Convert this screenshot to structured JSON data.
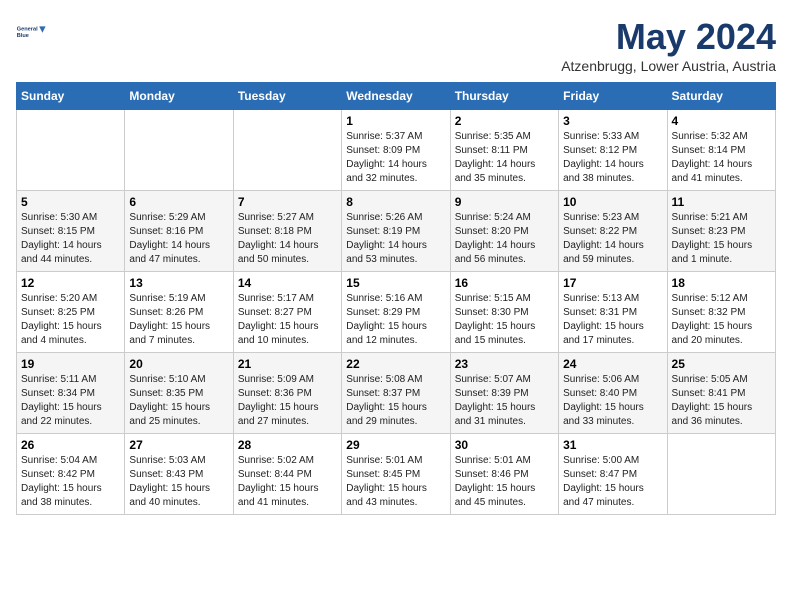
{
  "header": {
    "logo_line1": "General",
    "logo_line2": "Blue",
    "month": "May 2024",
    "location": "Atzenbrugg, Lower Austria, Austria"
  },
  "weekdays": [
    "Sunday",
    "Monday",
    "Tuesday",
    "Wednesday",
    "Thursday",
    "Friday",
    "Saturday"
  ],
  "weeks": [
    [
      {
        "day": "",
        "sunrise": "",
        "sunset": "",
        "daylight": ""
      },
      {
        "day": "",
        "sunrise": "",
        "sunset": "",
        "daylight": ""
      },
      {
        "day": "",
        "sunrise": "",
        "sunset": "",
        "daylight": ""
      },
      {
        "day": "1",
        "sunrise": "Sunrise: 5:37 AM",
        "sunset": "Sunset: 8:09 PM",
        "daylight": "Daylight: 14 hours and 32 minutes."
      },
      {
        "day": "2",
        "sunrise": "Sunrise: 5:35 AM",
        "sunset": "Sunset: 8:11 PM",
        "daylight": "Daylight: 14 hours and 35 minutes."
      },
      {
        "day": "3",
        "sunrise": "Sunrise: 5:33 AM",
        "sunset": "Sunset: 8:12 PM",
        "daylight": "Daylight: 14 hours and 38 minutes."
      },
      {
        "day": "4",
        "sunrise": "Sunrise: 5:32 AM",
        "sunset": "Sunset: 8:14 PM",
        "daylight": "Daylight: 14 hours and 41 minutes."
      }
    ],
    [
      {
        "day": "5",
        "sunrise": "Sunrise: 5:30 AM",
        "sunset": "Sunset: 8:15 PM",
        "daylight": "Daylight: 14 hours and 44 minutes."
      },
      {
        "day": "6",
        "sunrise": "Sunrise: 5:29 AM",
        "sunset": "Sunset: 8:16 PM",
        "daylight": "Daylight: 14 hours and 47 minutes."
      },
      {
        "day": "7",
        "sunrise": "Sunrise: 5:27 AM",
        "sunset": "Sunset: 8:18 PM",
        "daylight": "Daylight: 14 hours and 50 minutes."
      },
      {
        "day": "8",
        "sunrise": "Sunrise: 5:26 AM",
        "sunset": "Sunset: 8:19 PM",
        "daylight": "Daylight: 14 hours and 53 minutes."
      },
      {
        "day": "9",
        "sunrise": "Sunrise: 5:24 AM",
        "sunset": "Sunset: 8:20 PM",
        "daylight": "Daylight: 14 hours and 56 minutes."
      },
      {
        "day": "10",
        "sunrise": "Sunrise: 5:23 AM",
        "sunset": "Sunset: 8:22 PM",
        "daylight": "Daylight: 14 hours and 59 minutes."
      },
      {
        "day": "11",
        "sunrise": "Sunrise: 5:21 AM",
        "sunset": "Sunset: 8:23 PM",
        "daylight": "Daylight: 15 hours and 1 minute."
      }
    ],
    [
      {
        "day": "12",
        "sunrise": "Sunrise: 5:20 AM",
        "sunset": "Sunset: 8:25 PM",
        "daylight": "Daylight: 15 hours and 4 minutes."
      },
      {
        "day": "13",
        "sunrise": "Sunrise: 5:19 AM",
        "sunset": "Sunset: 8:26 PM",
        "daylight": "Daylight: 15 hours and 7 minutes."
      },
      {
        "day": "14",
        "sunrise": "Sunrise: 5:17 AM",
        "sunset": "Sunset: 8:27 PM",
        "daylight": "Daylight: 15 hours and 10 minutes."
      },
      {
        "day": "15",
        "sunrise": "Sunrise: 5:16 AM",
        "sunset": "Sunset: 8:29 PM",
        "daylight": "Daylight: 15 hours and 12 minutes."
      },
      {
        "day": "16",
        "sunrise": "Sunrise: 5:15 AM",
        "sunset": "Sunset: 8:30 PM",
        "daylight": "Daylight: 15 hours and 15 minutes."
      },
      {
        "day": "17",
        "sunrise": "Sunrise: 5:13 AM",
        "sunset": "Sunset: 8:31 PM",
        "daylight": "Daylight: 15 hours and 17 minutes."
      },
      {
        "day": "18",
        "sunrise": "Sunrise: 5:12 AM",
        "sunset": "Sunset: 8:32 PM",
        "daylight": "Daylight: 15 hours and 20 minutes."
      }
    ],
    [
      {
        "day": "19",
        "sunrise": "Sunrise: 5:11 AM",
        "sunset": "Sunset: 8:34 PM",
        "daylight": "Daylight: 15 hours and 22 minutes."
      },
      {
        "day": "20",
        "sunrise": "Sunrise: 5:10 AM",
        "sunset": "Sunset: 8:35 PM",
        "daylight": "Daylight: 15 hours and 25 minutes."
      },
      {
        "day": "21",
        "sunrise": "Sunrise: 5:09 AM",
        "sunset": "Sunset: 8:36 PM",
        "daylight": "Daylight: 15 hours and 27 minutes."
      },
      {
        "day": "22",
        "sunrise": "Sunrise: 5:08 AM",
        "sunset": "Sunset: 8:37 PM",
        "daylight": "Daylight: 15 hours and 29 minutes."
      },
      {
        "day": "23",
        "sunrise": "Sunrise: 5:07 AM",
        "sunset": "Sunset: 8:39 PM",
        "daylight": "Daylight: 15 hours and 31 minutes."
      },
      {
        "day": "24",
        "sunrise": "Sunrise: 5:06 AM",
        "sunset": "Sunset: 8:40 PM",
        "daylight": "Daylight: 15 hours and 33 minutes."
      },
      {
        "day": "25",
        "sunrise": "Sunrise: 5:05 AM",
        "sunset": "Sunset: 8:41 PM",
        "daylight": "Daylight: 15 hours and 36 minutes."
      }
    ],
    [
      {
        "day": "26",
        "sunrise": "Sunrise: 5:04 AM",
        "sunset": "Sunset: 8:42 PM",
        "daylight": "Daylight: 15 hours and 38 minutes."
      },
      {
        "day": "27",
        "sunrise": "Sunrise: 5:03 AM",
        "sunset": "Sunset: 8:43 PM",
        "daylight": "Daylight: 15 hours and 40 minutes."
      },
      {
        "day": "28",
        "sunrise": "Sunrise: 5:02 AM",
        "sunset": "Sunset: 8:44 PM",
        "daylight": "Daylight: 15 hours and 41 minutes."
      },
      {
        "day": "29",
        "sunrise": "Sunrise: 5:01 AM",
        "sunset": "Sunset: 8:45 PM",
        "daylight": "Daylight: 15 hours and 43 minutes."
      },
      {
        "day": "30",
        "sunrise": "Sunrise: 5:01 AM",
        "sunset": "Sunset: 8:46 PM",
        "daylight": "Daylight: 15 hours and 45 minutes."
      },
      {
        "day": "31",
        "sunrise": "Sunrise: 5:00 AM",
        "sunset": "Sunset: 8:47 PM",
        "daylight": "Daylight: 15 hours and 47 minutes."
      },
      {
        "day": "",
        "sunrise": "",
        "sunset": "",
        "daylight": ""
      }
    ]
  ]
}
